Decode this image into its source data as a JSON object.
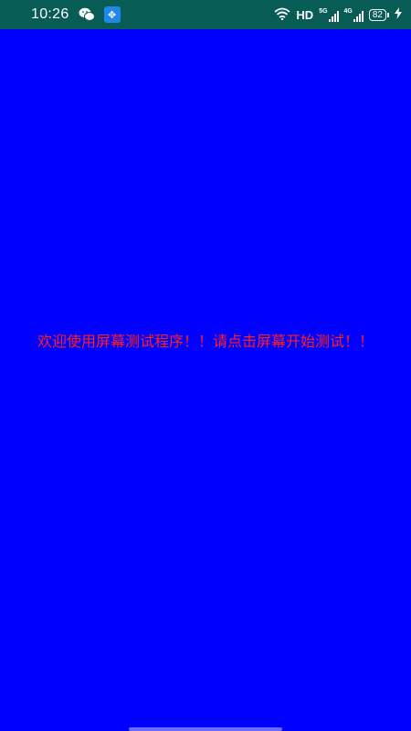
{
  "status_bar": {
    "time": "10:26",
    "hd_label": "HD",
    "network_1": "5G",
    "network_2": "4G",
    "battery_level": "82"
  },
  "main": {
    "welcome_text": "欢迎使用屏幕测试程序！！请点击屏幕开始测试！！"
  },
  "colors": {
    "background": "#0000ff",
    "status_bar": "#075c55",
    "text": "#ff1f1f"
  }
}
